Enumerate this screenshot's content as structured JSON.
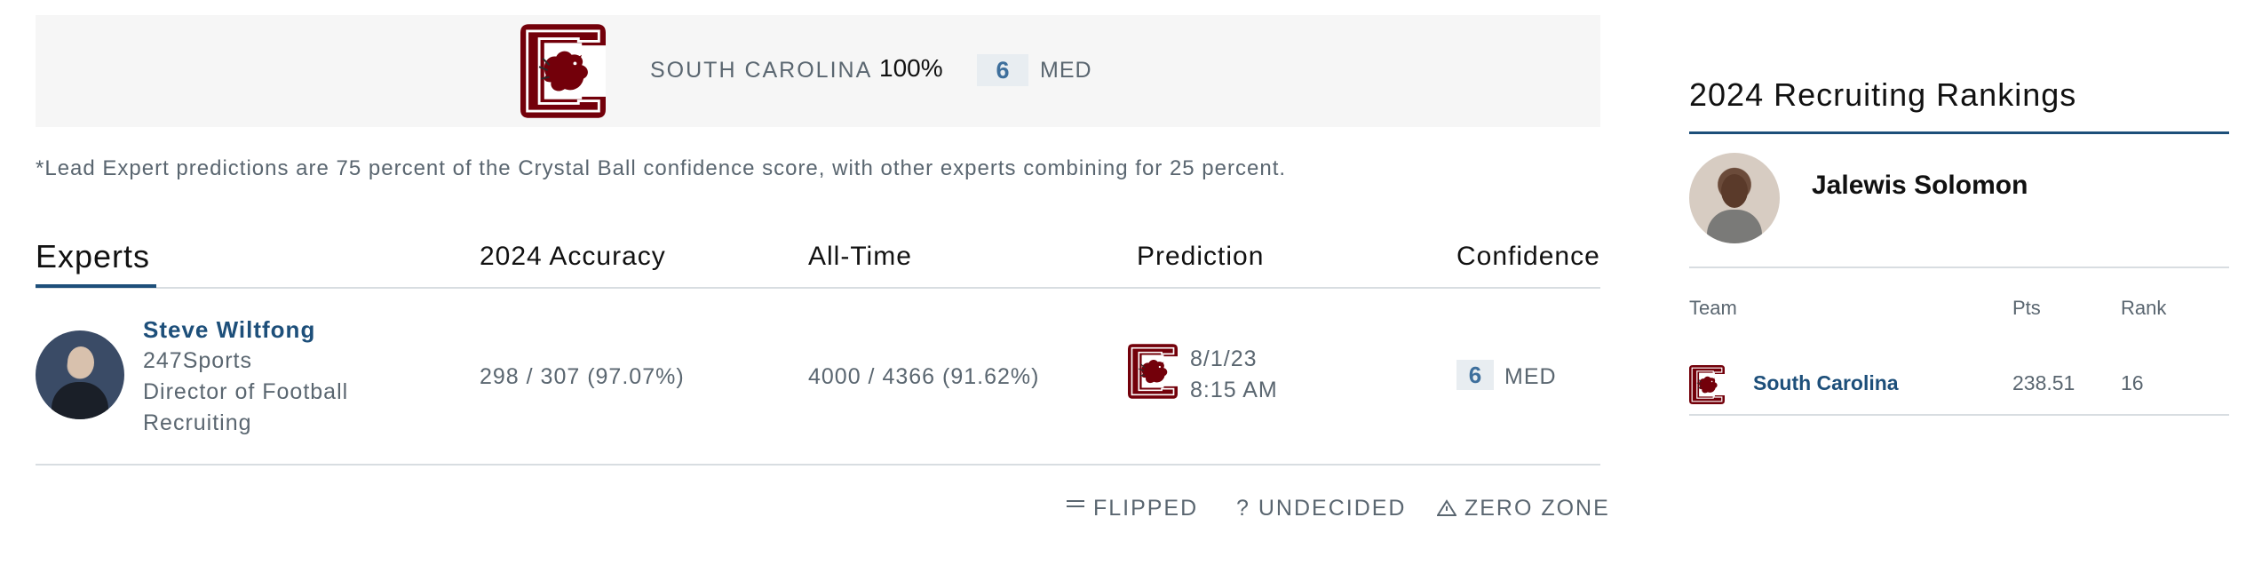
{
  "prediction_banner": {
    "team": "SOUTH CAROLINA",
    "percent": "100%",
    "confidence": "6",
    "confidence_label": "MED"
  },
  "footnote": "*Lead Expert predictions are 75 percent of the Crystal Ball confidence score, with other experts combining for 25 percent.",
  "table": {
    "headers": {
      "experts": "Experts",
      "accuracy": "2024 Accuracy",
      "all_time": "All-Time",
      "prediction": "Prediction",
      "confidence": "Confidence"
    },
    "rows": [
      {
        "name": "Steve Wiltfong",
        "org": "247Sports",
        "title_line1": "Director of Football",
        "title_line2": "Recruiting",
        "accuracy": "298 / 307 (97.07%)",
        "all_time": "4000 / 4366 (91.62%)",
        "date": "8/1/23",
        "time": "8:15 AM",
        "confidence": "6",
        "confidence_label": "MED"
      }
    ]
  },
  "legend": {
    "flipped": "FLIPPED",
    "undecided": "UNDECIDED",
    "zero_zone": "ZERO ZONE",
    "flipped_icon": "flip-icon",
    "undecided_icon": "question-icon",
    "zero_zone_icon": "warning-triangle-icon"
  },
  "rankings": {
    "title": "2024 Recruiting Rankings",
    "player": "Jalewis Solomon",
    "headers": {
      "team": "Team",
      "pts": "Pts",
      "rank": "Rank"
    },
    "rows": [
      {
        "team": "South Carolina",
        "pts": "238.51",
        "rank": "16"
      }
    ]
  },
  "colors": {
    "accent": "#1d4f7a",
    "team_garnet": "#73000a",
    "confidence_bg": "#e8edf1",
    "banner_bg": "#f6f6f6"
  }
}
